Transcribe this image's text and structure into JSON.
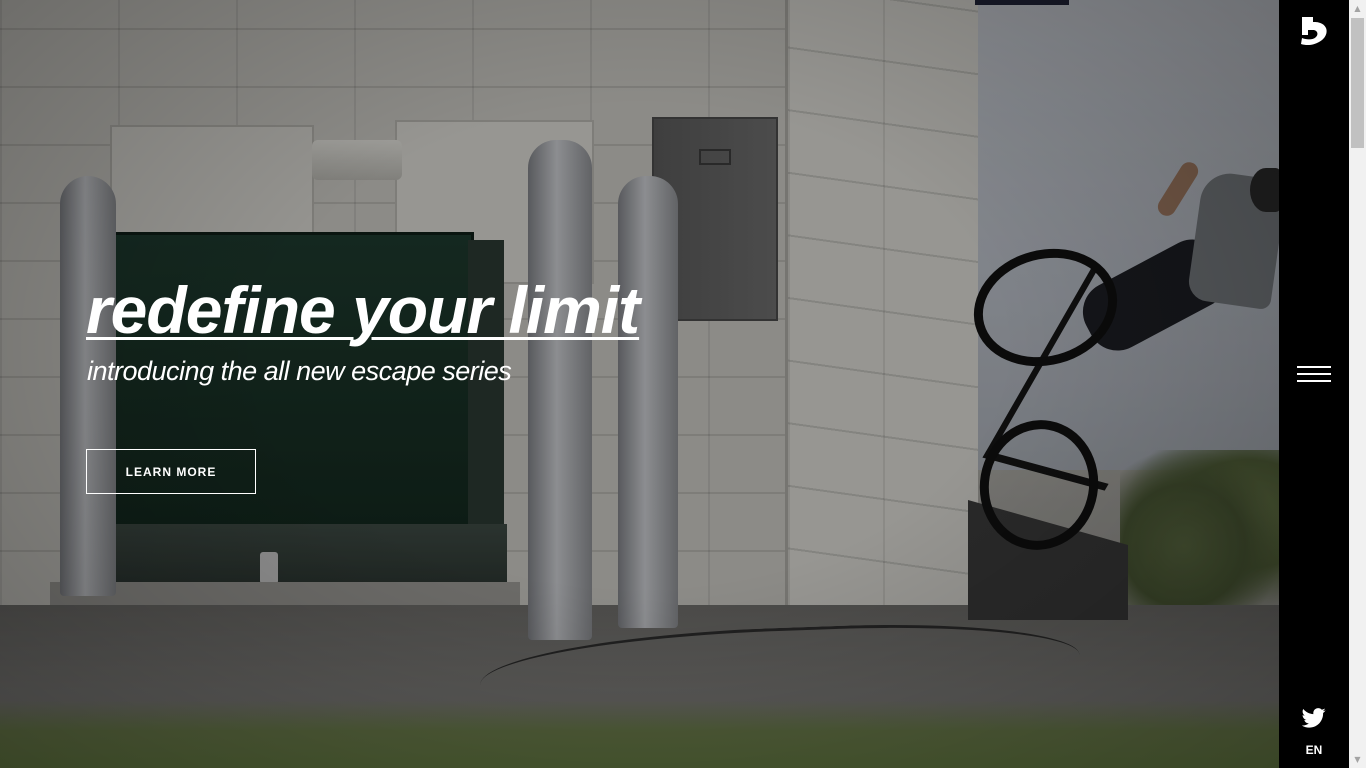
{
  "hero": {
    "title": "redefine your limit",
    "subtitle": "introducing the all new escape series",
    "cta_label": "LEARN MORE",
    "background_image": "bmx-rider-tailwhip-by-building"
  },
  "sidebar": {
    "logo": "s-logo-icon",
    "menu_icon": "hamburger-menu-icon",
    "social_icon": "twitter-icon",
    "language": "EN"
  },
  "colors": {
    "sidebar_bg": "#000000",
    "text": "#ffffff",
    "cta_border": "#ffffff"
  }
}
